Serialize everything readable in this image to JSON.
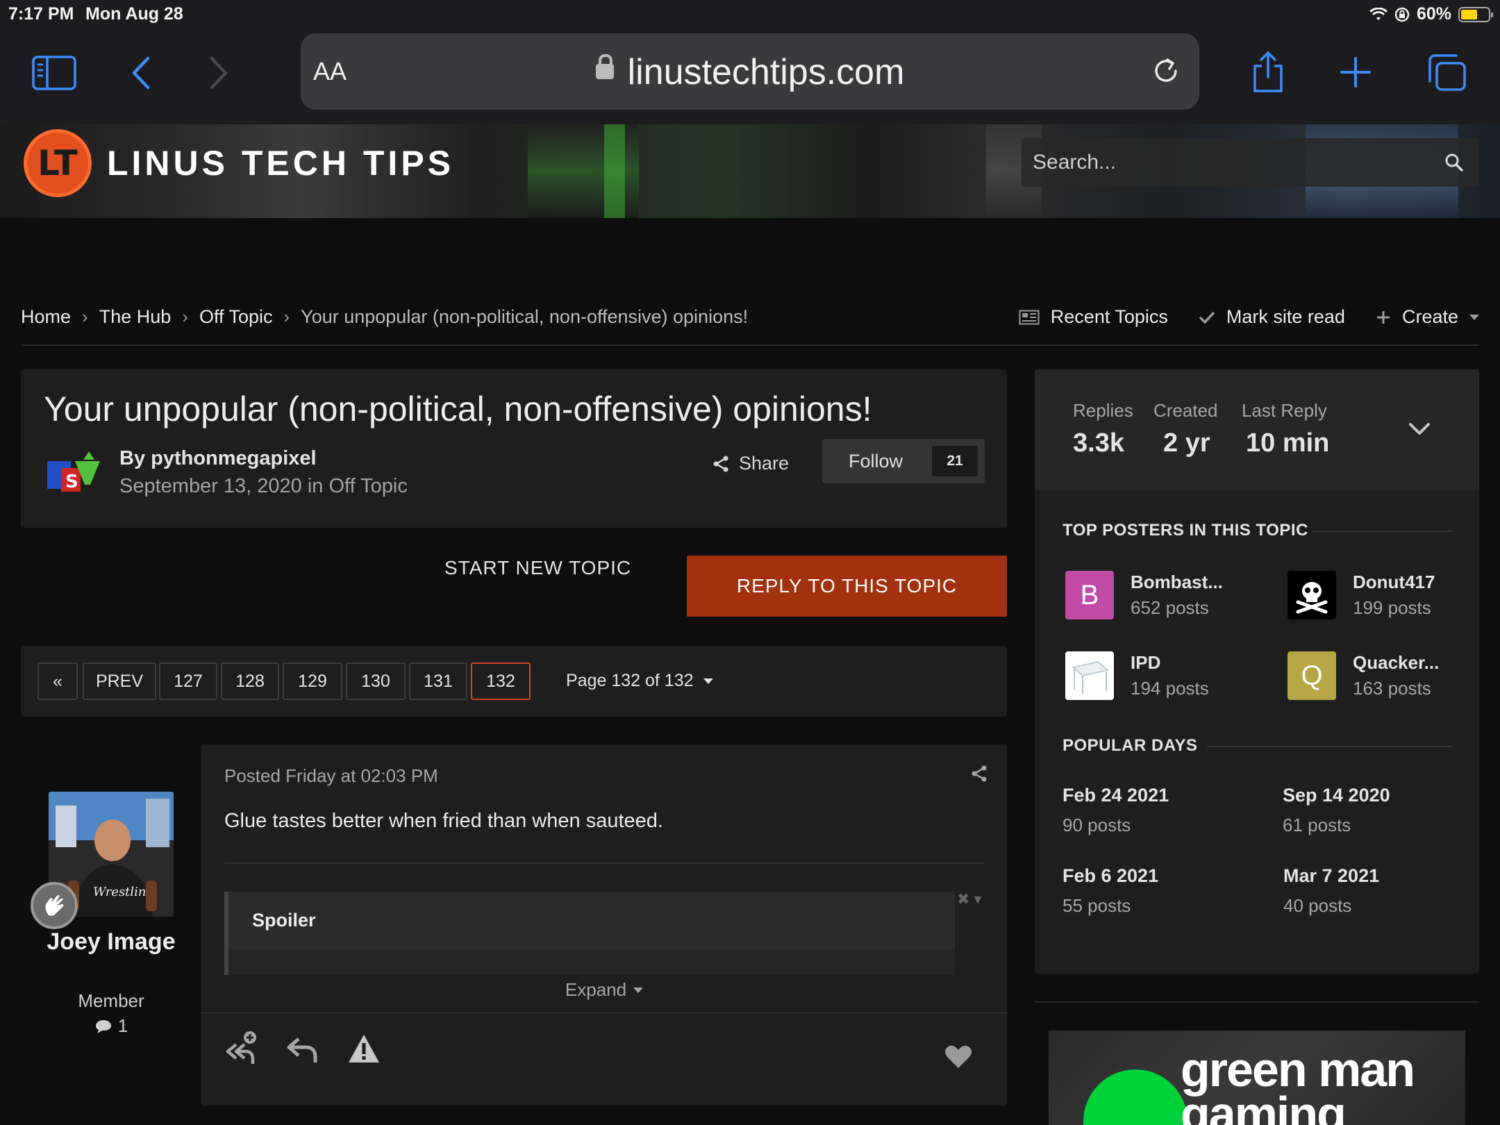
{
  "status_bar": {
    "time": "7:17 PM",
    "date": "Mon Aug 28",
    "battery": "60%",
    "battery_level": 0.6
  },
  "browser": {
    "aa_label": "AA",
    "url": "linustechtips.com"
  },
  "site": {
    "name": "LINUS TECH TIPS",
    "logo_mark": "LT",
    "search_placeholder": "Search...",
    "accent": "#a3300e"
  },
  "breadcrumb": [
    "Home",
    "The Hub",
    "Off Topic",
    "Your unpopular (non-political, non-offensive) opinions!"
  ],
  "bc_actions": {
    "recent": "Recent Topics",
    "mark_read": "Mark site read",
    "create": "Create"
  },
  "topic": {
    "title": "Your unpopular (non-political, non-offensive) opinions!",
    "by": "By pythonmegapixel",
    "date_line": "September 13, 2020 in Off Topic",
    "share": "Share",
    "follow": "Follow",
    "follow_count": "21"
  },
  "actions": {
    "start_topic": "START NEW TOPIC",
    "reply": "REPLY TO THIS TOPIC"
  },
  "pagination": {
    "first": "«",
    "prev": "PREV",
    "pages": [
      "127",
      "128",
      "129",
      "130",
      "131",
      "132"
    ],
    "current": "132",
    "page_label": "Page 132 of 132"
  },
  "post": {
    "author_name": "Joey Image",
    "author_rank": "Member",
    "author_count": "1",
    "meta": "Posted Friday at 02:03 PM",
    "text": "Glue tastes better when fried than when sauteed.",
    "spoiler_label": "Spoiler",
    "expand": "Expand"
  },
  "sidebar": {
    "stats": [
      {
        "label": "Replies",
        "value": "3.3k"
      },
      {
        "label": "Created",
        "value": "2 yr"
      },
      {
        "label": "Last Reply",
        "value": "10 min"
      }
    ],
    "top_posters_title": "TOP POSTERS IN THIS TOPIC",
    "top_posters": [
      {
        "name": "Bombast...",
        "posts": "652 posts",
        "initial": "B",
        "color": "#c34ba8"
      },
      {
        "name": "Donut417",
        "posts": "199 posts",
        "initial": "",
        "color": "#000000"
      },
      {
        "name": "IPD",
        "posts": "194 posts",
        "initial": "",
        "color": "#ffffff"
      },
      {
        "name": "Quacker...",
        "posts": "163 posts",
        "initial": "Q",
        "color": "#b8a546"
      }
    ],
    "popular_days_title": "POPULAR DAYS",
    "popular_days": [
      {
        "date": "Feb 24 2021",
        "posts": "90 posts"
      },
      {
        "date": "Sep 14 2020",
        "posts": "61 posts"
      },
      {
        "date": "Feb 6 2021",
        "posts": "55 posts"
      },
      {
        "date": "Mar 7 2021",
        "posts": "40 posts"
      }
    ]
  },
  "ad": {
    "text_line1": "green man",
    "text_line2": "gaming"
  }
}
